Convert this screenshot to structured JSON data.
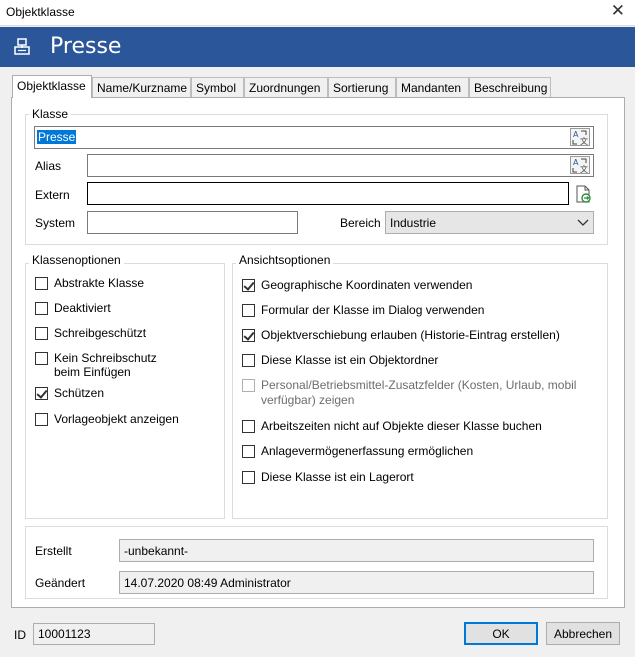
{
  "window": {
    "title": "Objektklasse"
  },
  "header": {
    "name": "Presse"
  },
  "tabs": [
    "Objektklasse",
    "Name/Kurzname",
    "Symbol",
    "Zuordnungen",
    "Sortierung",
    "Mandanten",
    "Beschreibung"
  ],
  "klasse": {
    "group_label": "Klasse",
    "name_value": "Presse",
    "alias_label": "Alias",
    "alias_value": "",
    "extern_label": "Extern",
    "extern_value": "",
    "system_label": "System",
    "system_value": "",
    "bereich_label": "Bereich",
    "bereich_value": "Industrie"
  },
  "klassenoptionen": {
    "label": "Klassenoptionen",
    "items": [
      {
        "label": "Abstrakte Klasse",
        "checked": false
      },
      {
        "label": "Deaktiviert",
        "checked": false
      },
      {
        "label": "Schreibgeschützt",
        "checked": false
      },
      {
        "label": "Kein Schreibschutz beim Einfügen",
        "checked": false
      },
      {
        "label": "Schützen",
        "checked": true
      },
      {
        "label": "Vorlageobjekt anzeigen",
        "checked": false
      }
    ]
  },
  "ansichtsoptionen": {
    "label": "Ansichtsoptionen",
    "items": [
      {
        "label": "Geographische Koordinaten verwenden",
        "checked": true,
        "disabled": false
      },
      {
        "label": "Formular der Klasse im Dialog verwenden",
        "checked": false,
        "disabled": false
      },
      {
        "label": "Objektverschiebung erlauben (Historie-Eintrag erstellen)",
        "checked": true,
        "disabled": false
      },
      {
        "label": "Diese Klasse ist ein Objektordner",
        "checked": false,
        "disabled": false
      },
      {
        "label": "Personal/Betriebsmittel-Zusatzfelder (Kosten, Urlaub, mobil verfügbar) zeigen",
        "checked": false,
        "disabled": true
      },
      {
        "label": "Arbeitszeiten nicht auf Objekte dieser Klasse buchen",
        "checked": false,
        "disabled": false
      },
      {
        "label": "Anlagevermögenerfassung ermöglichen",
        "checked": false,
        "disabled": false
      },
      {
        "label": "Diese Klasse ist ein Lagerort",
        "checked": false,
        "disabled": false
      }
    ]
  },
  "info": {
    "erstellt_label": "Erstellt",
    "erstellt_value": "-unbekannt-",
    "geaendert_label": "Geändert",
    "geaendert_value": "14.07.2020 08:49 Administrator"
  },
  "footer": {
    "id_label": "ID",
    "id_value": "10001123",
    "ok_label": "OK",
    "cancel_label": "Abbrechen"
  },
  "colors": {
    "banner": "#2b579a",
    "selection": "#0078d7"
  }
}
